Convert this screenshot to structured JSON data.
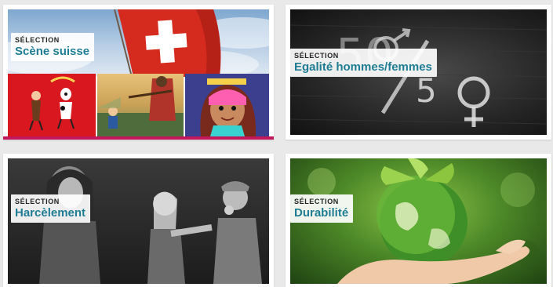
{
  "colors": {
    "page_bg": "#e9e9e9",
    "title_teal": "#1f7d93",
    "accent_pink": "#c2185b",
    "swiss_red": "#d52b1e"
  },
  "cards": [
    {
      "eyebrow": "SÉLECTION",
      "title": "Scène suisse"
    },
    {
      "eyebrow": "SÉLECTION",
      "title": "Egalité hommes/femmes",
      "image_text": "50/50"
    },
    {
      "eyebrow": "SÉLECTION",
      "title": "Harcèlement"
    },
    {
      "eyebrow": "SÉLECTION",
      "title": "Durabilité"
    }
  ]
}
